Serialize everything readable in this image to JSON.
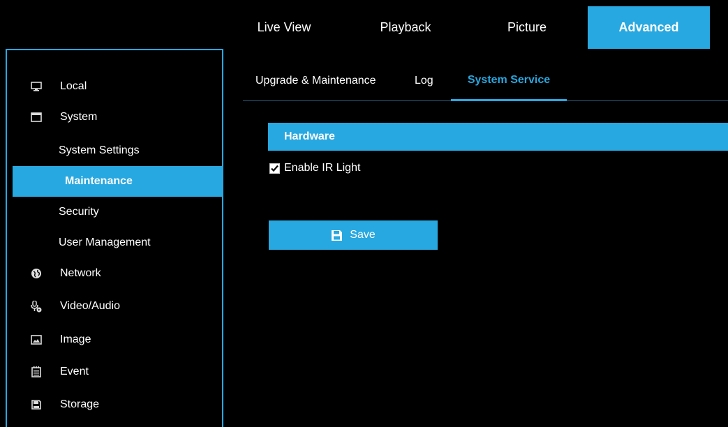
{
  "topnav": {
    "tabs": [
      {
        "label": "Live View"
      },
      {
        "label": "Playback"
      },
      {
        "label": "Picture"
      },
      {
        "label": "Advanced"
      }
    ],
    "active_index": 3
  },
  "sidebar": {
    "items": [
      {
        "label": "Local",
        "icon": "monitor-icon"
      },
      {
        "label": "System",
        "icon": "window-icon"
      },
      {
        "label": "System Settings"
      },
      {
        "label": "Maintenance"
      },
      {
        "label": "Security"
      },
      {
        "label": "User Management"
      },
      {
        "label": "Network",
        "icon": "globe-icon"
      },
      {
        "label": "Video/Audio",
        "icon": "microphone-icon"
      },
      {
        "label": "Image",
        "icon": "image-icon"
      },
      {
        "label": "Event",
        "icon": "calendar-icon"
      },
      {
        "label": "Storage",
        "icon": "disk-icon"
      }
    ],
    "active_label": "Maintenance"
  },
  "subtabs": [
    {
      "label": "Upgrade & Maintenance"
    },
    {
      "label": "Log"
    },
    {
      "label": "System Service"
    }
  ],
  "hardware": {
    "title": "Hardware",
    "ir_light_label": "Enable IR Light",
    "ir_light_checked": true
  },
  "save_label": "Save",
  "colors": {
    "accent": "#28a8e0",
    "background": "#000000"
  }
}
